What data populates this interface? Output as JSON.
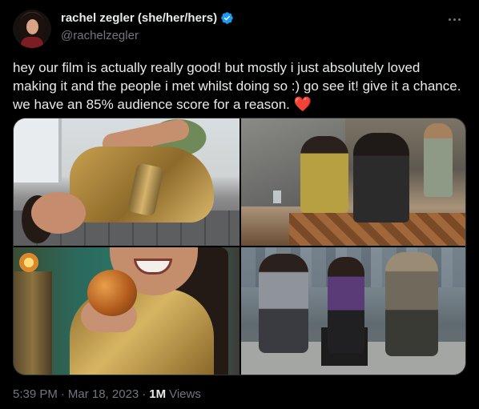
{
  "author": {
    "display_name": "rachel zegler (she/her/hers)",
    "handle": "@rachelzegler",
    "verified": true,
    "verified_color": "#1d9bf0",
    "avatar_icon": "profile-photo"
  },
  "tweet": {
    "text": "hey our film is actually really good! but mostly i just absolutely loved making it and the people i met whilst doing so :) go see it! give it a chance. we have an 85% audience score for a reason.",
    "emoji": "❤️",
    "media": [
      {
        "kind": "photo",
        "subject": "photo-1"
      },
      {
        "kind": "photo",
        "subject": "photo-2"
      },
      {
        "kind": "photo",
        "subject": "photo-3"
      },
      {
        "kind": "photo",
        "subject": "photo-4"
      }
    ]
  },
  "footer": {
    "time": "5:39 PM",
    "separator": "·",
    "date": "Mar 18, 2023",
    "views_count": "1M",
    "views_label": "Views"
  },
  "colors": {
    "background": "#000000",
    "text": "#e7e9ea",
    "muted": "#71767b",
    "heart": "#f91880",
    "border": "#2f3336"
  }
}
